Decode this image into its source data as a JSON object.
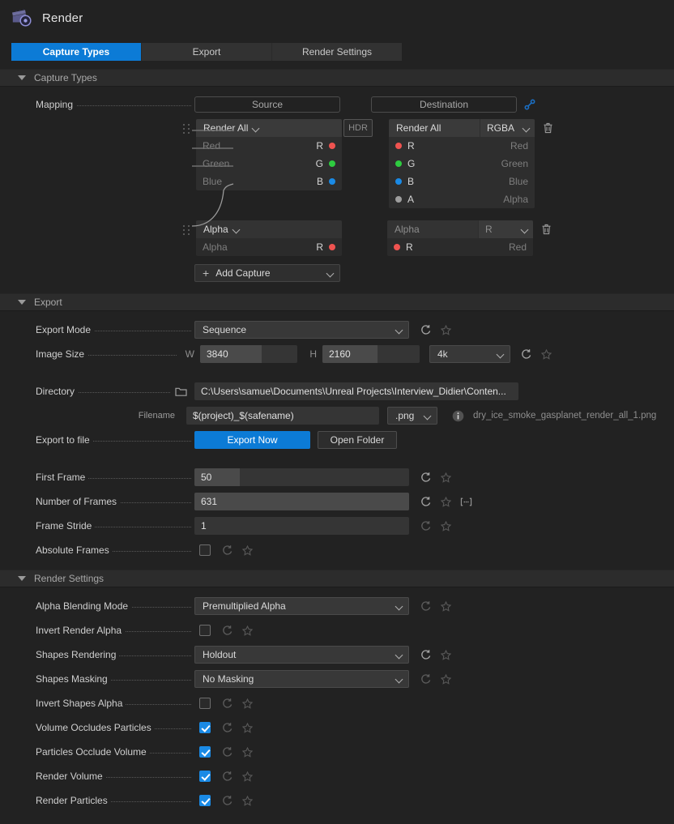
{
  "window": {
    "title": "Render",
    "icon": "clapperboard-record-icon"
  },
  "tabs": [
    {
      "id": "capture-types",
      "label": "Capture Types",
      "active": true
    },
    {
      "id": "export",
      "label": "Export",
      "active": false
    },
    {
      "id": "render-settings",
      "label": "Render Settings",
      "active": false
    }
  ],
  "colors": {
    "accent": "#0c7bd6",
    "checkbox_on": "#1a8ae5",
    "channel_red": "#ef5350",
    "channel_green": "#2ecc40",
    "channel_blue": "#1a8ae5",
    "channel_alpha": "#9e9e9e",
    "link_icon": "#1b6fc4",
    "panel_bg": "#222222",
    "section_bg": "#2c2c2c"
  },
  "capture_types": {
    "section_label": "Capture Types",
    "mapping_label": "Mapping",
    "source_header": "Source",
    "destination_header": "Destination",
    "link_icon": "link-chain-icon",
    "captures": [
      {
        "source_name": "Render All",
        "hdr_badge": "HDR",
        "destination_name": "Render All",
        "destination_format": "RGBA",
        "source_channels": [
          {
            "name": "Red",
            "letter": "R",
            "color": "#ef5350"
          },
          {
            "name": "Green",
            "letter": "G",
            "color": "#2ecc40"
          },
          {
            "name": "Blue",
            "letter": "B",
            "color": "#1a8ae5"
          }
        ],
        "destination_channels": [
          {
            "letter": "R",
            "name": "Red",
            "color": "#ef5350"
          },
          {
            "letter": "G",
            "name": "Green",
            "color": "#2ecc40"
          },
          {
            "letter": "B",
            "name": "Blue",
            "color": "#1a8ae5"
          },
          {
            "letter": "A",
            "name": "Alpha",
            "color": "#9e9e9e"
          }
        ],
        "delete_icon": "trash-icon"
      },
      {
        "source_name": "Alpha",
        "destination_name": "Alpha",
        "destination_format": "R",
        "source_channels": [
          {
            "name": "Alpha",
            "letter": "R",
            "color": "#ef5350"
          }
        ],
        "destination_channels": [
          {
            "letter": "R",
            "name": "Red",
            "color": "#ef5350"
          }
        ],
        "delete_icon": "trash-icon"
      }
    ],
    "add_capture_label": "Add Capture"
  },
  "export": {
    "section_label": "Export",
    "export_mode": {
      "label": "Export Mode",
      "value": "Sequence"
    },
    "image_size": {
      "label": "Image Size",
      "w_prefix": "W",
      "width": "3840",
      "h_prefix": "H",
      "height": "2160",
      "preset": "4k"
    },
    "directory": {
      "label": "Directory",
      "icon": "folder-icon",
      "value": "C:\\Users\\samue\\Documents\\Unreal Projects\\Interview_Didier\\Conten..."
    },
    "filename": {
      "label": "Filename",
      "value": "$(project)_$(safename)",
      "extension": ".png",
      "info_icon": "info-icon",
      "preview": "dry_ice_smoke_gasplanet_render_all_1.png"
    },
    "export_to_file": {
      "label": "Export to file",
      "export_now": "Export Now",
      "open_folder": "Open Folder"
    },
    "first_frame": {
      "label": "First Frame",
      "value": "50"
    },
    "number_of_frames": {
      "label": "Number of Frames",
      "value": "631"
    },
    "frame_stride": {
      "label": "Frame Stride",
      "value": "1"
    },
    "absolute_frames": {
      "label": "Absolute Frames",
      "checked": false
    }
  },
  "render_settings": {
    "section_label": "Render Settings",
    "rows": [
      {
        "label": "Alpha Blending Mode",
        "type": "select",
        "value": "Premultiplied Alpha",
        "dim": true
      },
      {
        "label": "Invert Render Alpha",
        "type": "checkbox",
        "checked": false,
        "dim": true
      },
      {
        "label": "Shapes Rendering",
        "type": "select",
        "value": "Holdout",
        "dim": false
      },
      {
        "label": "Shapes Masking",
        "type": "select",
        "value": "No Masking",
        "dim": true
      },
      {
        "label": "Invert Shapes Alpha",
        "type": "checkbox",
        "checked": false,
        "dim": true
      },
      {
        "label": "Volume Occludes Particles",
        "type": "checkbox",
        "checked": true,
        "dim": true
      },
      {
        "label": "Particles Occlude Volume",
        "type": "checkbox",
        "checked": true,
        "dim": true
      },
      {
        "label": "Render Volume",
        "type": "checkbox",
        "checked": true,
        "dim": true
      },
      {
        "label": "Render Particles",
        "type": "checkbox",
        "checked": true,
        "dim": true
      }
    ]
  },
  "icons": {
    "reset": "reset-arrow-icon",
    "favorite": "star-icon",
    "expand": "expand-range-icon"
  }
}
